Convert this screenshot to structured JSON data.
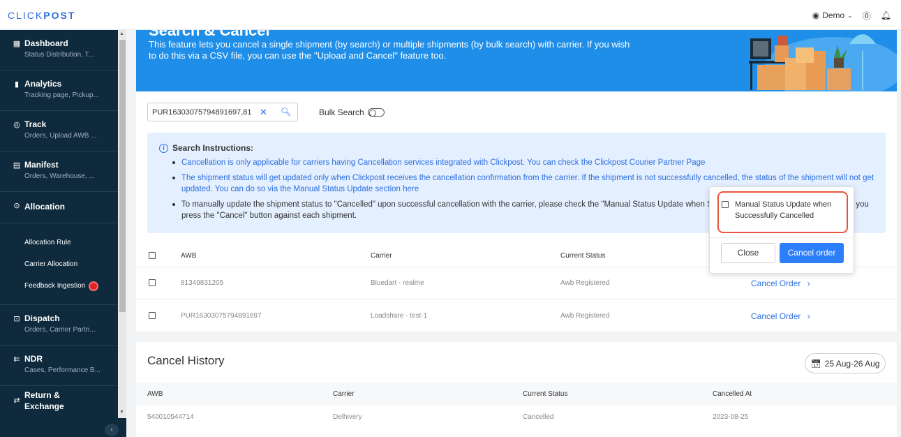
{
  "header": {
    "logo_prefix": "CLICK",
    "logo_suffix": "POST",
    "user": "Demo"
  },
  "sidebar": {
    "items": [
      {
        "title": "Dashboard",
        "sub": "Status Distribution, T..."
      },
      {
        "title": "Analytics",
        "sub": "Tracking page, Pickup..."
      },
      {
        "title": "Track",
        "sub": "Orders, Upload AWB ..."
      },
      {
        "title": "Manifest",
        "sub": "Orders, Warehouse, ..."
      },
      {
        "title": "Allocation",
        "sub": ""
      },
      {
        "title": "Dispatch",
        "sub": "Orders, Carrier Partn..."
      },
      {
        "title": "NDR",
        "sub": "Cases, Performance B..."
      },
      {
        "title": "Return & Exchange",
        "sub": ""
      }
    ],
    "allocation_sub": [
      "Allocation Rule",
      "Carrier Allocation",
      "Feedback Ingestion"
    ]
  },
  "hero": {
    "title": "Search & Cancel",
    "desc": "This feature lets you cancel a single shipment (by search) or multiple shipments (by bulk search) with carrier. If you wish to do this via a CSV file, you can use the \"Upload and Cancel\" feature too."
  },
  "search": {
    "value": "PUR16303075794891697,81",
    "bulk_label": "Bulk Search"
  },
  "instructions": {
    "heading": "Search Instructions:",
    "items": [
      "Cancellation is only applicable for carriers having Cancellation services integrated with Clickpost. You can check the Clickpost Courier Partner Page",
      "The shipment status will get updated only when Clickpost receives the cancellation confirmation from the carrier. If the shipment is not successfully cancelled, the status of the shipment will not get updated. You can do so via the Manual Status Update section here",
      "To manually update the shipment status to \"Cancelled\" upon successful cancellation with the carrier, please check the \"Manual Status Update when Successfully Cancelled\" checkbox before you press the \"Cancel\" button against each shipment."
    ]
  },
  "table": {
    "headers": [
      "AWB",
      "Carrier",
      "Current Status"
    ],
    "rows": [
      {
        "awb": "81349831205",
        "carrier": "Bluedart - realme",
        "status": "Awb Registered",
        "action": "Cancel Order"
      },
      {
        "awb": "PUR16303075794891697",
        "carrier": "Loadshare - test-1",
        "status": "Awb Registered",
        "action": "Cancel Order"
      }
    ]
  },
  "popup": {
    "checkbox_label": "Manual Status Update when Successfully Cancelled",
    "close": "Close",
    "confirm": "Cancel order"
  },
  "history": {
    "title": "Cancel History",
    "date_range": "25 Aug-26 Aug",
    "headers": [
      "AWB",
      "Carrier",
      "Current Status",
      "Cancelled At"
    ],
    "rows": [
      {
        "awb": "540010544714",
        "carrier": "Delhivery",
        "status": "Cancelled",
        "cancelled_at": "2023-08-25"
      }
    ]
  },
  "colors": {
    "brand_blue": "#2d6fe0",
    "sidebar_bg": "#0f2a3c",
    "hero_bg": "#1f8ee8",
    "highlight": "#e8543d"
  },
  "icons": [
    "dashboard-icon",
    "analytics-icon",
    "location-icon",
    "manifest-icon",
    "allocation-icon",
    "dispatch-icon",
    "ndr-icon",
    "return-icon",
    "user-icon",
    "help-icon",
    "bell-icon",
    "search-icon",
    "clear-icon",
    "info-icon",
    "calendar-icon",
    "chevron-right-icon",
    "chevron-left-icon"
  ]
}
